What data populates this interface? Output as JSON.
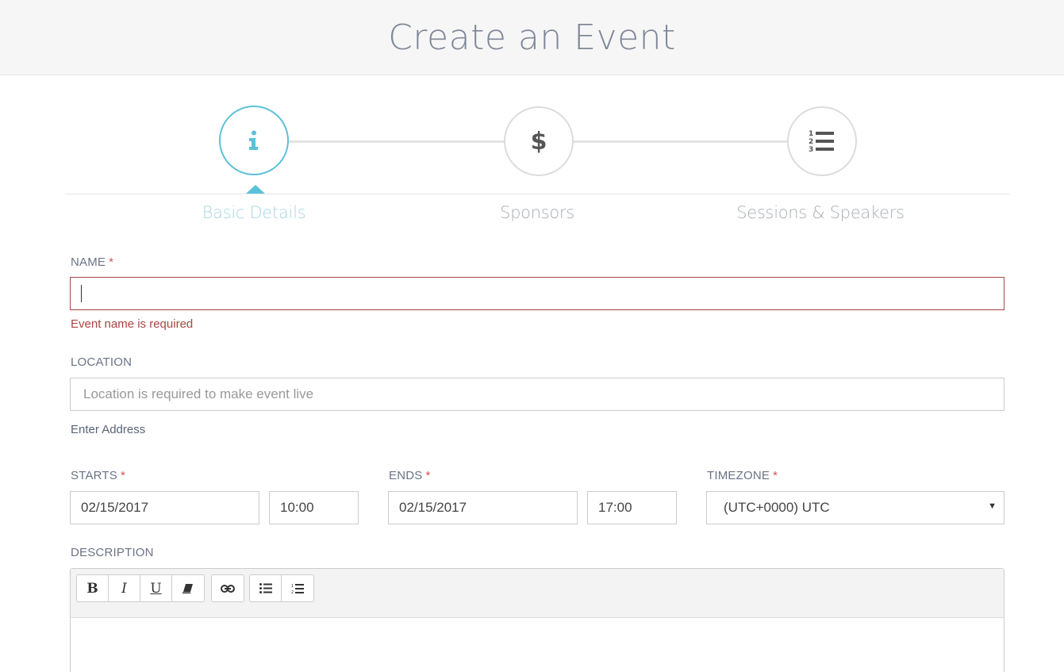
{
  "header": {
    "title": "Create an Event"
  },
  "steps": [
    {
      "label": "Basic Details",
      "icon": "info-icon",
      "active": true
    },
    {
      "label": "Sponsors",
      "icon": "dollar-icon",
      "active": false
    },
    {
      "label": "Sessions & Speakers",
      "icon": "numbered-list-icon",
      "active": false
    }
  ],
  "colors": {
    "accent": "#5bc1d9",
    "error": "#a94442",
    "required": "#d9534f"
  },
  "form": {
    "name": {
      "label": "NAME",
      "required": "*",
      "value": "",
      "error": "Event name is required"
    },
    "location": {
      "label": "LOCATION",
      "placeholder": "Location is required to make event live",
      "helper": "Enter Address"
    },
    "starts": {
      "label": "STARTS",
      "required": "*",
      "date": "02/15/2017",
      "time": "10:00"
    },
    "ends": {
      "label": "ENDS",
      "required": "*",
      "date": "02/15/2017",
      "time": "17:00"
    },
    "timezone": {
      "label": "TIMEZONE",
      "required": "*",
      "value": "(UTC+0000) UTC"
    },
    "description": {
      "label": "DESCRIPTION"
    }
  },
  "toolbar": {
    "bold": "B",
    "italic": "I",
    "underline": "U"
  }
}
